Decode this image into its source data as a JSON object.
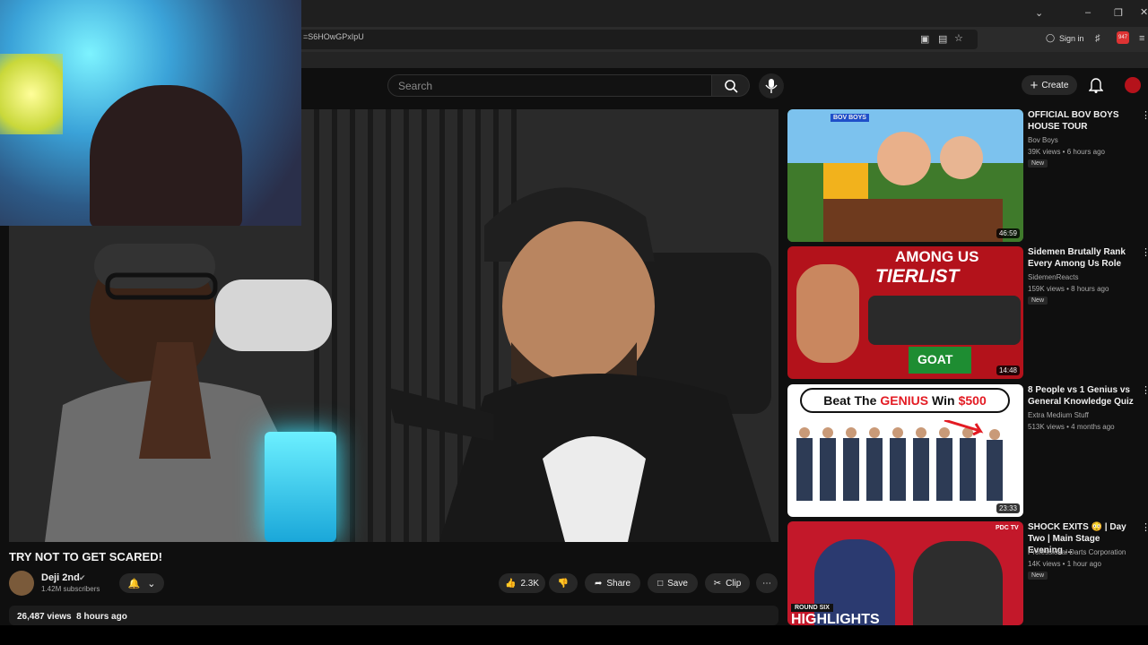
{
  "browser": {
    "url": "=S6HOwGPxIpU",
    "sign_in": "Sign in",
    "badge_count": "947"
  },
  "header": {
    "search_placeholder": "Search",
    "create_label": "Create"
  },
  "video": {
    "title": "TRY NOT TO GET SCARED!",
    "channel": "Deji 2nd",
    "subscribers": "1.42M subscribers",
    "likes": "2.3K",
    "share": "Share",
    "save": "Save",
    "clip": "Clip",
    "views_time": "26,487 views  8 hours ago"
  },
  "recommendations": [
    {
      "title": "OFFICIAL BOV BOYS HOUSE TOUR",
      "channel": "Bov Boys",
      "meta": "39K views • 6 hours ago",
      "badge": "New",
      "duration": "46:59",
      "thumb_color": "#3f7a2b",
      "thumb_tag": "BOV BOYS"
    },
    {
      "title": "Sidemen Brutally Rank Every Among Us Role",
      "channel": "SidemenReacts",
      "meta": "159K views • 8 hours ago",
      "badge": "New",
      "duration": "14:48",
      "thumb_color": "#b3121b",
      "thumb_text_1": "AMONG US",
      "thumb_text_2": "TIERLIST",
      "thumb_text_3": "GOAT"
    },
    {
      "title": "8 People vs 1 Genius vs General Knowledge Quiz",
      "channel": "Extra Medium Stuff",
      "meta": "513K views • 4 months ago",
      "duration": "23:33",
      "thumb_color": "#ffffff",
      "thumb_text_1": "Beat The",
      "thumb_text_2": "GENIUS",
      "thumb_text_3": "Win",
      "thumb_text_4": "$500"
    },
    {
      "title": "SHOCK EXITS 😳 | Day Two | Main Stage Evening ...",
      "channel": "Professional Darts Corporation",
      "meta": "14K views • 1 hour ago",
      "badge": "New",
      "thumb_color": "#c3182a",
      "thumb_tag": "ROUND SIX",
      "thumb_text_1": "HIGHLIGHTS",
      "thumb_logo": "PDC TV"
    }
  ]
}
